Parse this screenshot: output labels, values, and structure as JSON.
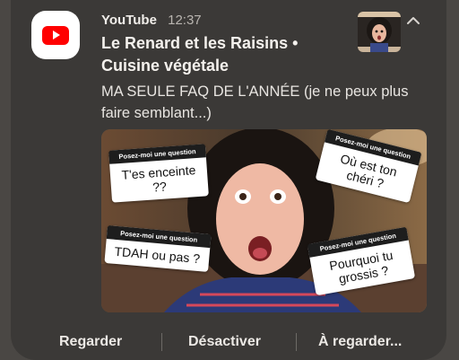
{
  "notification": {
    "app_name": "YouTube",
    "time": "12:37",
    "title": "Le Renard et les Raisins • Cuisine végétale",
    "description": "MA SEULE FAQ DE L'ANNÉE (je ne peux plus faire semblant...)",
    "app_icon": "youtube-icon",
    "expand_icon": "chevron-up-icon"
  },
  "thumbnail": {
    "stickers": [
      {
        "header": "Posez-moi une question",
        "question": "T'es enceinte ??"
      },
      {
        "header": "Posez-moi une question",
        "question": "Où est ton chéri ?"
      },
      {
        "header": "Posez-moi une question",
        "question": "TDAH ou pas ?"
      },
      {
        "header": "Posez-moi une question",
        "question": "Pourquoi tu grossis ?"
      }
    ]
  },
  "actions": {
    "watch": "Regarder",
    "disable": "Désactiver",
    "watch_later": "À regarder..."
  },
  "colors": {
    "card": "#3b3937",
    "youtube_red": "#ff0000"
  }
}
